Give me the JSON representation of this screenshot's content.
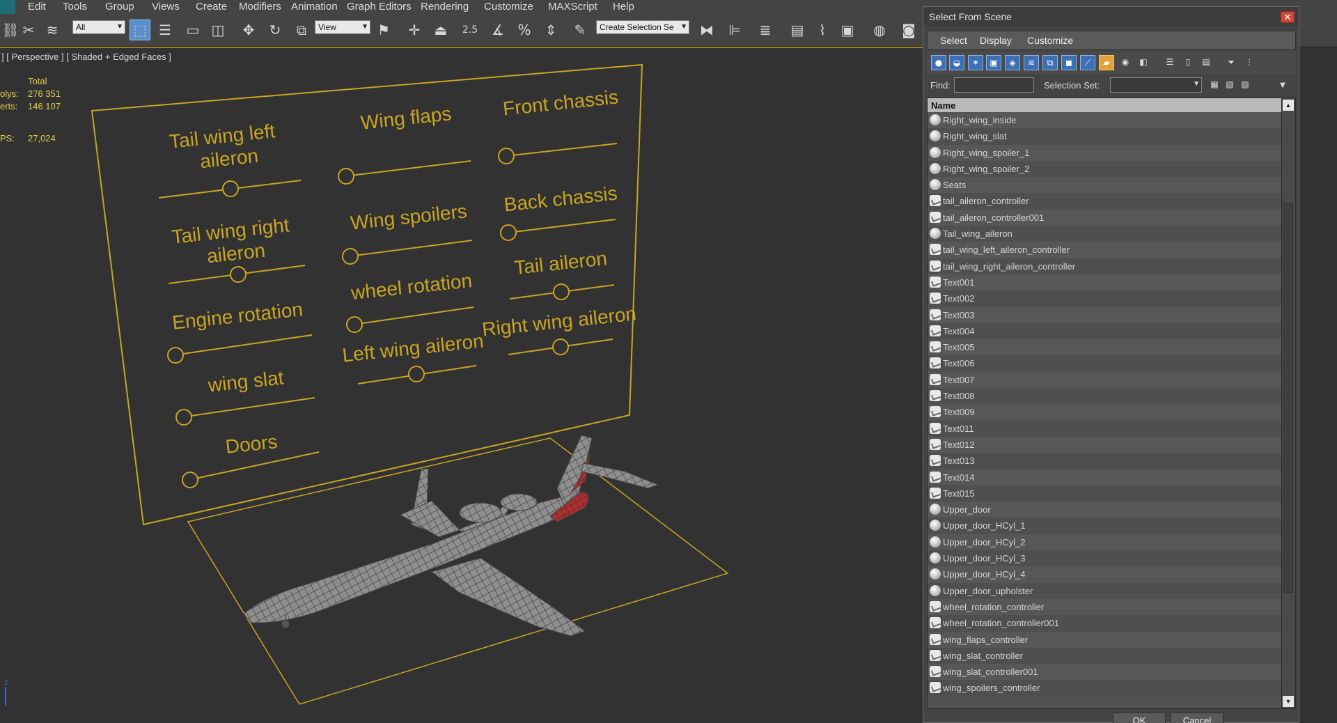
{
  "menubar": {
    "items": [
      "Edit",
      "Tools",
      "Group",
      "Views",
      "Create",
      "Modifiers",
      "Animation",
      "Graph Editors",
      "Rendering",
      "Customize",
      "MAXScript",
      "Help"
    ]
  },
  "toolbar": {
    "filter_value": "All",
    "coord_value": "View",
    "selection_set_placeholder": "Create Selection Se",
    "snap_angle_label": "2.5"
  },
  "viewport": {
    "label": "] [ Perspective ] [ Shaded + Edged Faces ]",
    "stats": {
      "total_label": "Total",
      "polys_label": "olys:",
      "polys_value": "276 351",
      "verts_label": "erts:",
      "verts_value": "146 107",
      "fps_label": "PS:",
      "fps_value": "27,024"
    },
    "axis_label": "z",
    "controls": [
      {
        "label": "Tail wing left",
        "label2": "aileron"
      },
      {
        "label": "Wing flaps"
      },
      {
        "label": "Front chassis"
      },
      {
        "label": "Tail wing right",
        "label2": "aileron"
      },
      {
        "label": "Wing spoilers"
      },
      {
        "label": "Back chassis"
      },
      {
        "label": "Engine rotation"
      },
      {
        "label": "wheel rotation"
      },
      {
        "label": "Tail aileron"
      },
      {
        "label": "wing slat"
      },
      {
        "label": "Left wing aileron"
      },
      {
        "label": "Right wing aileron"
      },
      {
        "label": "Doors"
      }
    ]
  },
  "dialog": {
    "title": "Select From Scene",
    "close": "✕",
    "menu": [
      "Select",
      "Display",
      "Customize"
    ],
    "find_label": "Find:",
    "find_value": "",
    "selection_set_label": "Selection Set:",
    "column_header": "Name",
    "items": [
      {
        "name": "Right_wing_inside",
        "icon": "sphere"
      },
      {
        "name": "Right_wing_slat",
        "icon": "sphere"
      },
      {
        "name": "Right_wing_spoiler_1",
        "icon": "sphere"
      },
      {
        "name": "Right_wing_spoiler_2",
        "icon": "sphere"
      },
      {
        "name": "Seats",
        "icon": "sphere"
      },
      {
        "name": "tail_aileron_controller",
        "icon": "shape"
      },
      {
        "name": "tail_aileron_controller001",
        "icon": "shape"
      },
      {
        "name": "Tail_wing_aileron",
        "icon": "sphere"
      },
      {
        "name": "tail_wing_left_aileron_controller",
        "icon": "shape"
      },
      {
        "name": "tail_wing_right_aileron_controller",
        "icon": "shape"
      },
      {
        "name": "Text001",
        "icon": "shape"
      },
      {
        "name": "Text002",
        "icon": "shape"
      },
      {
        "name": "Text003",
        "icon": "shape"
      },
      {
        "name": "Text004",
        "icon": "shape"
      },
      {
        "name": "Text005",
        "icon": "shape"
      },
      {
        "name": "Text006",
        "icon": "shape"
      },
      {
        "name": "Text007",
        "icon": "shape"
      },
      {
        "name": "Text008",
        "icon": "shape"
      },
      {
        "name": "Text009",
        "icon": "shape"
      },
      {
        "name": "Text011",
        "icon": "shape"
      },
      {
        "name": "Text012",
        "icon": "shape"
      },
      {
        "name": "Text013",
        "icon": "shape"
      },
      {
        "name": "Text014",
        "icon": "shape"
      },
      {
        "name": "Text015",
        "icon": "shape"
      },
      {
        "name": "Upper_door",
        "icon": "sphere"
      },
      {
        "name": "Upper_door_HCyl_1",
        "icon": "sphere"
      },
      {
        "name": "Upper_door_HCyl_2",
        "icon": "sphere"
      },
      {
        "name": "Upper_door_HCyl_3",
        "icon": "sphere"
      },
      {
        "name": "Upper_door_HCyl_4",
        "icon": "sphere"
      },
      {
        "name": "Upper_door_upholster",
        "icon": "sphere"
      },
      {
        "name": "wheel_rotation_controller",
        "icon": "shape"
      },
      {
        "name": "wheel_rotation_controller001",
        "icon": "shape"
      },
      {
        "name": "wing_flaps_controller",
        "icon": "shape"
      },
      {
        "name": "wing_slat_controller",
        "icon": "shape"
      },
      {
        "name": "wing_slat_controller001",
        "icon": "shape"
      },
      {
        "name": "wing_spoilers_controller",
        "icon": "shape"
      }
    ],
    "ok_label": "OK",
    "cancel_label": "Cancel"
  },
  "colors": {
    "viewport_bg": "#323232",
    "accent_yellow": "#c9a524",
    "selection_blue": "#3d6fb4"
  }
}
